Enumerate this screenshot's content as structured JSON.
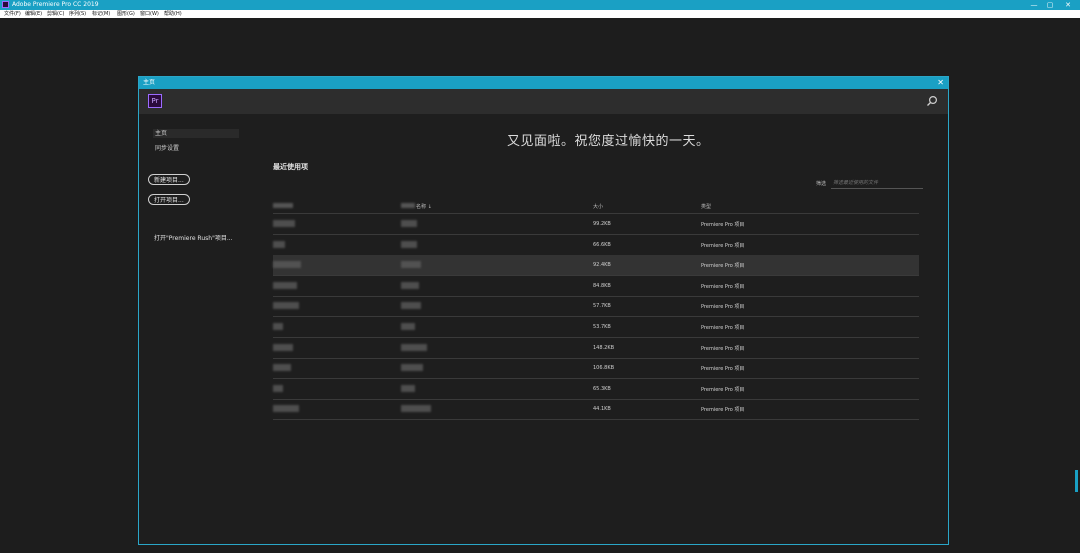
{
  "window": {
    "title": "Adobe Premiere Pro CC 2019",
    "controls": [
      "—",
      "▢",
      "✕"
    ]
  },
  "menubar": [
    "文件(F)",
    "编辑(E)",
    "剪辑(C)",
    "序列(S)",
    "标记(M)",
    "图形(G)",
    "窗口(W)",
    "帮助(H)"
  ],
  "dialog": {
    "title": "主页",
    "close": "✕",
    "logo": "Pr",
    "sidebar": {
      "home": "主页",
      "sync": "同步设置",
      "new_project": "新建项目...",
      "open_project": "打开项目...",
      "open_rush": "打开\"Premiere Rush\"项目..."
    },
    "greeting": "又见面啦。祝您度过愉快的一天。",
    "recent_title": "最近使用项",
    "filter_label": "筛选",
    "filter_placeholder": "筛选最近使用的文件",
    "columns": {
      "name_sort": "名称 ↓",
      "size": "大小",
      "type": "类型"
    },
    "rows": [
      {
        "size": "99.2KB",
        "type": "Premiere Pro 项目"
      },
      {
        "size": "66.6KB",
        "type": "Premiere Pro 项目"
      },
      {
        "size": "92.4KB",
        "type": "Premiere Pro 项目"
      },
      {
        "size": "84.8KB",
        "type": "Premiere Pro 项目"
      },
      {
        "size": "57.7KB",
        "type": "Premiere Pro 项目"
      },
      {
        "size": "53.7KB",
        "type": "Premiere Pro 项目"
      },
      {
        "size": "148.2KB",
        "type": "Premiere Pro 项目"
      },
      {
        "size": "106.8KB",
        "type": "Premiere Pro 项目"
      },
      {
        "size": "65.3KB",
        "type": "Premiere Pro 项目"
      },
      {
        "size": "44.1KB",
        "type": "Premiere Pro 项目"
      }
    ],
    "selected_row": 2
  }
}
